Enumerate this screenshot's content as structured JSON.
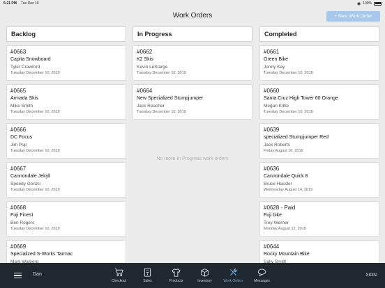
{
  "status_bar": {
    "time": "5:21 PM",
    "date": "Tue Dec 10",
    "battery": "100%"
  },
  "header": {
    "title": "Work Orders",
    "new_button": "+ New Work Order"
  },
  "columns": [
    {
      "title": "Backlog",
      "cards": [
        {
          "number": "#0663",
          "item": "Capita Snowboard",
          "customer": "Tyler Crawford",
          "date": "Tuesday December 10, 2019"
        },
        {
          "number": "#0665",
          "item": "Armada Skis",
          "customer": "Mike Smith",
          "date": "Tuesday December 10, 2019"
        },
        {
          "number": "#0666",
          "item": "DC Focus",
          "customer": "Jim Pop",
          "date": "Tuesday December 10, 2019"
        },
        {
          "number": "#0667",
          "item": "Cannondale Jekyll",
          "customer": "Speedy Gonzo",
          "date": "Tuesday December 10, 2019"
        },
        {
          "number": "#0668",
          "item": "Fuji Finest",
          "customer": "Ben Rogers",
          "date": "Tuesday December 10, 2019"
        },
        {
          "number": "#0669",
          "item": "Specialized S-Works Tarmac",
          "customer": "Mark Walberg",
          "date": ""
        }
      ]
    },
    {
      "title": "In Progress",
      "cards": [
        {
          "number": "#0662",
          "item": "K2 Skis",
          "customer": "Kevin LeStarge",
          "date": "Tuesday December 10, 2019"
        },
        {
          "number": "#0664",
          "item": "New Specialized Stumpjumper",
          "customer": "Jack Reacher",
          "date": "Tuesday December 10, 2019"
        }
      ],
      "empty_message": "No more In Progress work orders"
    },
    {
      "title": "Completed",
      "cards": [
        {
          "number": "#0661",
          "item": "Green Bike",
          "customer": "Jonny Kay",
          "date": "Tuesday December 10, 2019"
        },
        {
          "number": "#0660",
          "item": "Santa Cruz High Tower 60 Orange",
          "customer": "Megan Kittle",
          "date": "Tuesday December 10, 2019"
        },
        {
          "number": "#0639",
          "item": "specialized Stumpjumper Red",
          "customer": "Jack Roberts",
          "date": "Friday August 16, 2019"
        },
        {
          "number": "#0636",
          "item": "Cannondale Quick 8",
          "customer": "Bruce Hassler",
          "date": "Wednesday August 14, 2019"
        },
        {
          "number": "#0628 - Paid",
          "item": "Fuji bike",
          "customer": "Trey Werner",
          "date": "Monday August 12, 2019"
        },
        {
          "number": "#0644",
          "item": "Rocky Mountain Bike",
          "customer": "Sally Smith",
          "date": ""
        }
      ]
    }
  ],
  "tab_bar": {
    "user": "Dan",
    "brand": "XION",
    "active_color": "#7aa9d8",
    "tabs": [
      {
        "label": "Checkout",
        "icon": "cart-icon"
      },
      {
        "label": "Sales",
        "icon": "receipt-icon"
      },
      {
        "label": "Products",
        "icon": "shirt-icon"
      },
      {
        "label": "Inventory",
        "icon": "box-icon"
      },
      {
        "label": "Work Orders",
        "icon": "tools-icon",
        "active": true
      },
      {
        "label": "Messages",
        "icon": "chat-bubble-icon"
      }
    ]
  }
}
